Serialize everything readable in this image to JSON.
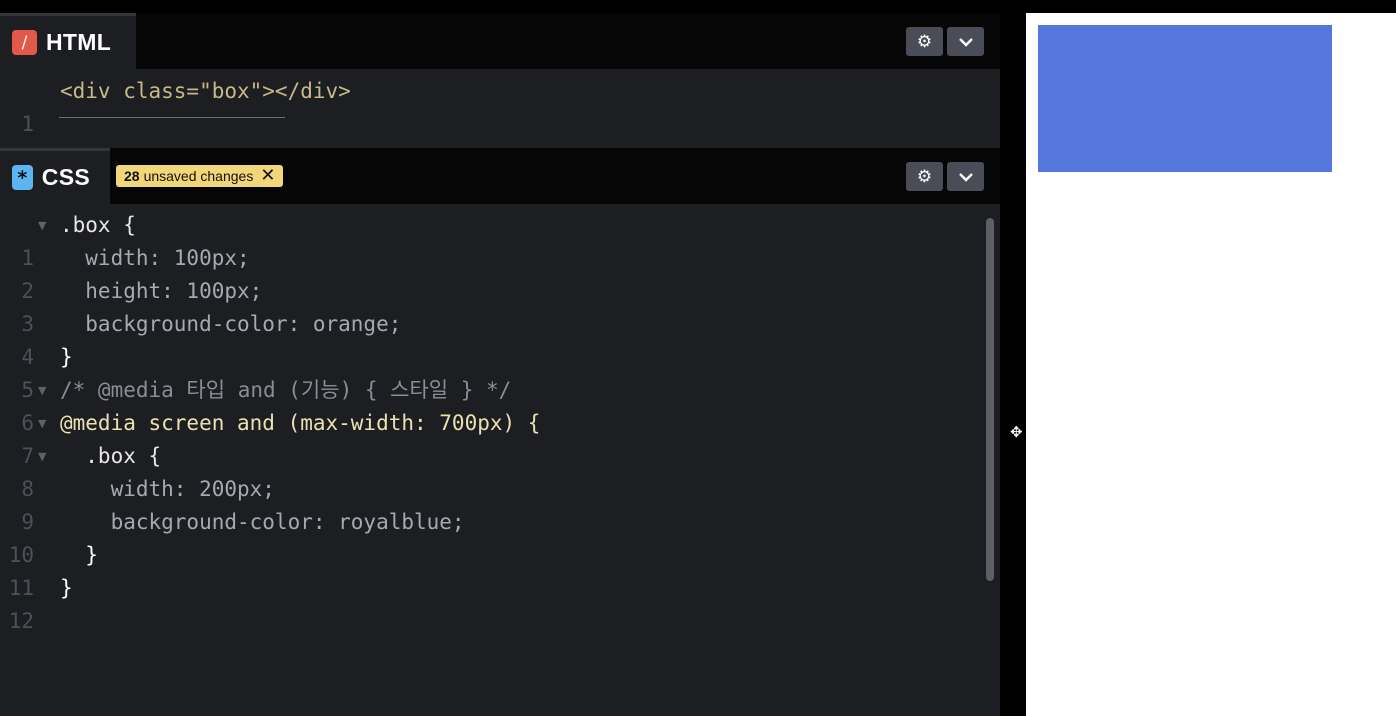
{
  "html_pane": {
    "tab_label": "HTML",
    "icon": "slash-icon",
    "lines": [
      {
        "num": "1",
        "text": "<div class=\"box\"></div>"
      }
    ]
  },
  "css_pane": {
    "tab_label": "CSS",
    "icon": "asterisk-icon",
    "badge_count": "28",
    "badge_text": "unsaved changes",
    "lines": [
      {
        "num": "1",
        "text": ".box {"
      },
      {
        "num": "2",
        "text": "  width: 100px;"
      },
      {
        "num": "3",
        "text": "  height: 100px;"
      },
      {
        "num": "4",
        "text": "  background-color: orange;"
      },
      {
        "num": "5",
        "text": "}"
      },
      {
        "num": "6",
        "text": "/* @media 타입 and (기능) { 스타일 } */"
      },
      {
        "num": "7",
        "text": "@media screen and (max-width: 700px) {"
      },
      {
        "num": "8",
        "text": "  .box {"
      },
      {
        "num": "9",
        "text": "    width: 200px;"
      },
      {
        "num": "10",
        "text": "    background-color: royalblue;"
      },
      {
        "num": "11",
        "text": "  }"
      },
      {
        "num": "12",
        "text": "}"
      }
    ]
  },
  "buttons": {
    "settings_icon": "gear-icon",
    "collapse_icon": "chevron-down-icon"
  },
  "preview": {
    "box_color": "#5577dd",
    "background": "#ffffff"
  },
  "colors": {
    "editor_bg": "#1d1e22",
    "badge_bg": "#f2d77a",
    "html_icon": "#e2594a",
    "css_icon": "#5cb4f1"
  }
}
